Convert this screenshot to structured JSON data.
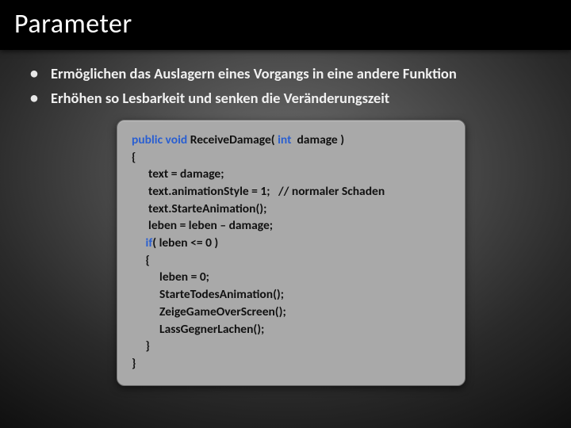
{
  "title": "Parameter",
  "bullets": [
    "Ermöglichen das Auslagern eines Vorgangs in eine andere Funktion",
    "Erhöhen so Lesbarkeit und senken die Veränderungszeit"
  ],
  "code": {
    "sig_public_void": "public void",
    "sig_name": " ReceiveDamage( ",
    "sig_int": "int",
    "sig_rest": "  damage )",
    "l_open": "{",
    "l1": "      text = damage;",
    "l2": "      text.animationStyle = 1;   // normaler Schaden",
    "l3": "      text.StarteAnimation();",
    "l4": "      leben = leben – damage;",
    "if_kw": "     if",
    "if_rest": "( leben <= 0 )",
    "l_if_open": "     {",
    "l5": "          leben = 0;",
    "l6": "          StarteTodesAnimation();",
    "l7": "          ZeigeGameOverScreen();",
    "l8": "          LassGegnerLachen();",
    "l_if_close": "     }",
    "l_close": "}"
  }
}
